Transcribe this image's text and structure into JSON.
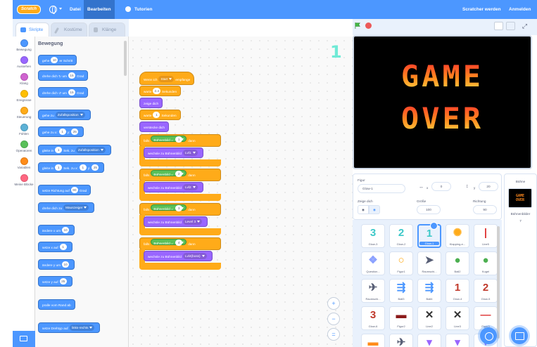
{
  "menubar": {
    "logo": "Scratch",
    "file": "Datei",
    "edit": "Bearbeiten",
    "tutorials": "Tutorien",
    "see_project_page": "Scratcher werden",
    "sign_in": "Anmelden"
  },
  "tabs": {
    "code": "Skripte",
    "costumes": "Kostüme",
    "sounds": "Klänge"
  },
  "categories": [
    {
      "label": "Bewegung",
      "color": "#4c97ff"
    },
    {
      "label": "Aussehen",
      "color": "#9966ff"
    },
    {
      "label": "Klang",
      "color": "#cf63cf"
    },
    {
      "label": "Ereignisse",
      "color": "#ffbf00"
    },
    {
      "label": "Steuerung",
      "color": "#ffab19"
    },
    {
      "label": "Fühlen",
      "color": "#5cb1d6"
    },
    {
      "label": "Operatoren",
      "color": "#59c059"
    },
    {
      "label": "Variablen",
      "color": "#ff8c1a"
    },
    {
      "label": "Meine Blöcke",
      "color": "#ff6680"
    }
  ],
  "palette": {
    "heading": "Bewegung",
    "move": {
      "a": "gehe",
      "n": "10",
      "b": "er Schritt"
    },
    "turn_right": {
      "a": "drehe dich",
      "b": "um",
      "n": "15",
      "c": "Grad"
    },
    "turn_left": {
      "a": "drehe dich",
      "b": "um",
      "n": "15",
      "c": "Grad"
    },
    "goto": {
      "a": "gehe zu",
      "dd": "Zufallsposition"
    },
    "goto_xy": {
      "a": "gehe zu x:",
      "x": "1",
      "b": "y:",
      "y": "25"
    },
    "glide_to": {
      "a": "gleite in",
      "n": "1",
      "b": "Sek. zu",
      "dd": "Zufallsposition"
    },
    "glide_xy": {
      "a": "gleite in",
      "n": "1",
      "b": "Sek. zu x:",
      "x": "1",
      "c": "y:",
      "y": "25"
    },
    "point_dir": {
      "a": "setze Richtung auf",
      "n": "90",
      "b": "Grad"
    },
    "point_towards": {
      "a": "drehe dich zu",
      "dd": "Mauszeiger"
    },
    "change_x": {
      "a": "ändere x um",
      "n": "10"
    },
    "set_x": {
      "a": "setze x auf",
      "n": "1"
    },
    "change_y": {
      "a": "ändere y um",
      "n": "10"
    },
    "set_y": {
      "a": "setze y auf",
      "n": "25"
    },
    "bounce": "pralle vom Rand ab",
    "rotation": {
      "a": "setze Drehtyp auf",
      "dd": "links-rechts"
    }
  },
  "script": {
    "hat": {
      "a": "Wenn ich",
      "dd": "Start",
      "b": "empfange"
    },
    "wait1": {
      "a": "warte",
      "n": "2.4",
      "b": "Sekunden"
    },
    "show": "zeige dich",
    "wait2": {
      "a": "warte",
      "n": "1",
      "b": "Sekunden"
    },
    "hide": "verstecke dich",
    "ifs": [
      {
        "a": "falls",
        "rep": "Bühnenbild",
        "op": "=",
        "n": "1",
        "b": "dann",
        "body": "wechsle zu Bühnenbild",
        "dd": "Lvl1"
      },
      {
        "a": "falls",
        "rep": "Bühnenbild",
        "op": "=",
        "n": "2",
        "b": "dann",
        "body": "wechsle zu Bühnenbild",
        "dd": "Lvl2"
      },
      {
        "a": "falls",
        "rep": "Bühnenbild",
        "op": "=",
        "n": "3",
        "b": "dann",
        "body": "wechsle zu Bühnenbild",
        "dd": "Level 3"
      },
      {
        "a": "falls",
        "rep": "Bühnenbild",
        "op": "=",
        "n": "4",
        "b": "dann",
        "body": "wechsle zu Bühnenbild",
        "dd": "Lvl4(boss)"
      }
    ]
  },
  "zoom": {
    "in": "+",
    "out": "−",
    "reset": "="
  },
  "stage": {
    "line1": "GAME",
    "line2": "OVER"
  },
  "sprite_info": {
    "sprite_label": "Figur",
    "sprite_name": "Glow-1",
    "x_label": "x",
    "x_value": "0",
    "y_label": "y",
    "y_value": "20",
    "show_label": "Zeige dich",
    "size_label": "Größe",
    "size_value": "100",
    "direction_label": "Richtung",
    "direction_value": "90"
  },
  "sprites": [
    {
      "name": "Glow-3",
      "glyph": "3",
      "color": "#3cc8c8"
    },
    {
      "name": "Glow-2",
      "glyph": "2",
      "color": "#3cc8c8"
    },
    {
      "name": "Glow-1",
      "glyph": "1",
      "color": "#3cc8c8",
      "selected": true
    },
    {
      "name": "Klapping-e...",
      "glyph": "✺",
      "color": "#ffab19"
    },
    {
      "name": "Line5",
      "glyph": "|",
      "color": "#e03c3c"
    },
    {
      "name": "Question...",
      "glyph": "❖",
      "color": "#8aa0ff"
    },
    {
      "name": "Figur1",
      "glyph": "○",
      "color": "#ffab19"
    },
    {
      "name": "Raumschi...",
      "glyph": "➤",
      "color": "#575e75"
    },
    {
      "name": "Ball2",
      "glyph": "●",
      "color": "#4caf50"
    },
    {
      "name": "Kugel",
      "glyph": "●",
      "color": "#4caf50"
    },
    {
      "name": "Raumschi...",
      "glyph": "✈",
      "color": "#575e75"
    },
    {
      "name": "Ball3",
      "glyph": "⇶",
      "color": "#4c97ff"
    },
    {
      "name": "Ball4",
      "glyph": "⇶",
      "color": "#4c97ff"
    },
    {
      "name": "Glow-4",
      "glyph": "1",
      "color": "#c0392b"
    },
    {
      "name": "Glow-5",
      "glyph": "2",
      "color": "#c0392b"
    },
    {
      "name": "Glow-6",
      "glyph": "3",
      "color": "#c0392b"
    },
    {
      "name": "Figur2",
      "glyph": "▬",
      "color": "#8b1a1a"
    },
    {
      "name": "Line2",
      "glyph": "✕",
      "color": "#333333"
    },
    {
      "name": "Line3",
      "glyph": "✕",
      "color": "#333333"
    },
    {
      "name": "Figur3",
      "glyph": "—",
      "color": "#e03c3c"
    },
    {
      "name": "",
      "glyph": "▬",
      "color": "#ff8c1a"
    },
    {
      "name": "",
      "glyph": "✈",
      "color": "#575e75"
    },
    {
      "name": "",
      "glyph": "▾",
      "color": "#9966ff"
    },
    {
      "name": "",
      "glyph": "▾",
      "color": "#9966ff"
    },
    {
      "name": "",
      "glyph": "▾",
      "color": "#9966ff"
    }
  ],
  "stage_panel": {
    "title": "Bühne",
    "thumb_line1": "GAME",
    "thumb_line2": "OVER",
    "backdrops_label": "Bühnenbilder",
    "backdrops_count": "7"
  }
}
